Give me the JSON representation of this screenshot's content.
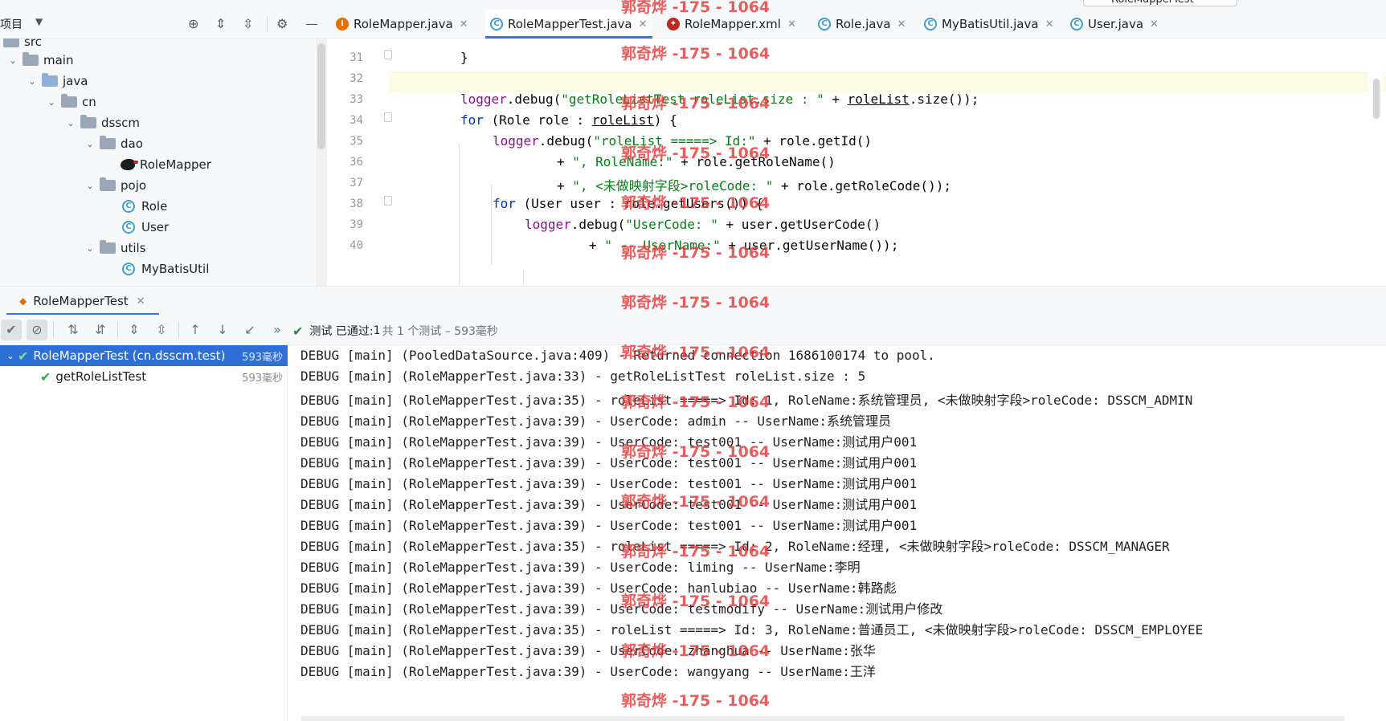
{
  "run_config": {
    "label": "RoleMapperTest"
  },
  "project_header": {
    "title": "项目"
  },
  "tabs": [
    {
      "label": "RoleMapper.java",
      "icon": "java-interface-icon"
    },
    {
      "label": "RoleMapperTest.java",
      "icon": "test-class-icon",
      "active": true
    },
    {
      "label": "RoleMapper.xml",
      "icon": "mybatis-xml-icon"
    },
    {
      "label": "Role.java",
      "icon": "class-icon"
    },
    {
      "label": "MyBatisUtil.java",
      "icon": "class-icon"
    },
    {
      "label": "User.java",
      "icon": "class-icon"
    }
  ],
  "tree": [
    {
      "label": "src"
    },
    {
      "label": "main"
    },
    {
      "label": "java"
    },
    {
      "label": "cn"
    },
    {
      "label": "dsscm"
    },
    {
      "label": "dao"
    },
    {
      "label": "RoleMapper"
    },
    {
      "label": "pojo"
    },
    {
      "label": "Role"
    },
    {
      "label": "User"
    },
    {
      "label": "utils"
    },
    {
      "label": "MyBatisUtil"
    }
  ],
  "editor": {
    "lines": [
      {
        "n": "31",
        "text": "}"
      },
      {
        "n": "32",
        "text": ""
      },
      {
        "n": "33",
        "a": "logger",
        "b": ".debug(",
        "c": "\"getRoleListTest roleList.size : \"",
        "d": " + ",
        "e": "roleList",
        "f": ".size());"
      },
      {
        "n": "34",
        "a": "for",
        "b": " (Role role : ",
        "c": "roleList",
        "d": ") {"
      },
      {
        "n": "35",
        "a": "logger",
        "b": ".debug(",
        "c": "\"roleList =====> Id:\"",
        "d": " + role.getId()"
      },
      {
        "n": "36",
        "a": "+ ",
        "b": "\", RoleName:\"",
        "c": " + role.getRoleName()"
      },
      {
        "n": "37",
        "a": "+ ",
        "b": "\", <未做映射字段>roleCode: \"",
        "c": " + role.getRoleCode());"
      },
      {
        "n": "38",
        "a": "for",
        "b": " (User user : role.getUsers()) {"
      },
      {
        "n": "39",
        "a": "logger",
        "b": ".debug(",
        "c": "\"UserCode: \"",
        "d": " + user.getUserCode()"
      },
      {
        "n": "40",
        "a": "+ ",
        "b": "\" -- UserName:\"",
        "c": " + user.getUserName());"
      }
    ]
  },
  "run_panel": {
    "tab_label": "RoleMapperTest",
    "status_label": "测试 已通过: ",
    "status_passed": "1",
    "status_count": "共 1 个测试 – 593毫秒"
  },
  "test_tree": [
    {
      "label": "RoleMapperTest (cn.dsscm.test)",
      "time": "593毫秒"
    },
    {
      "label": "getRoleListTest",
      "time": "593毫秒"
    }
  ],
  "console": [
    "DEBUG [main] (PooledDataSource.java:409) - Returned connection 1686100174 to pool.",
    "DEBUG [main] (RoleMapperTest.java:33) - getRoleListTest roleList.size : 5",
    "DEBUG [main] (RoleMapperTest.java:35) - roleList =====> Id: 1, RoleName:系统管理员, <未做映射字段>roleCode: DSSCM_ADMIN",
    "DEBUG [main] (RoleMapperTest.java:39) - UserCode: admin -- UserName:系统管理员",
    "DEBUG [main] (RoleMapperTest.java:39) - UserCode: test001 -- UserName:测试用户001",
    "DEBUG [main] (RoleMapperTest.java:39) - UserCode: test001 -- UserName:测试用户001",
    "DEBUG [main] (RoleMapperTest.java:39) - UserCode: test001 -- UserName:测试用户001",
    "DEBUG [main] (RoleMapperTest.java:39) - UserCode: test001 -- UserName:测试用户001",
    "DEBUG [main] (RoleMapperTest.java:39) - UserCode: test001 -- UserName:测试用户001",
    "DEBUG [main] (RoleMapperTest.java:35) - roleList =====> Id: 2, RoleName:经理, <未做映射字段>roleCode: DSSCM_MANAGER",
    "DEBUG [main] (RoleMapperTest.java:39) - UserCode: liming -- UserName:李明",
    "DEBUG [main] (RoleMapperTest.java:39) - UserCode: hanlubiao -- UserName:韩路彪",
    "DEBUG [main] (RoleMapperTest.java:39) - UserCode: testmodify -- UserName:测试用户修改",
    "DEBUG [main] (RoleMapperTest.java:35) - roleList =====> Id: 3, RoleName:普通员工, <未做映射字段>roleCode: DSSCM_EMPLOYEE",
    "DEBUG [main] (RoleMapperTest.java:39) - UserCode: zhanghua -- UserName:张华",
    "DEBUG [main] (RoleMapperTest.java:39) - UserCode: wangyang -- UserName:王洋"
  ],
  "watermark": "郭奇烨 -175 - 1064",
  "colors": {
    "accent": "#3574f0",
    "selection": "#2e6fd6",
    "pass": "#36a24a",
    "watermark": "#e13c3c"
  }
}
